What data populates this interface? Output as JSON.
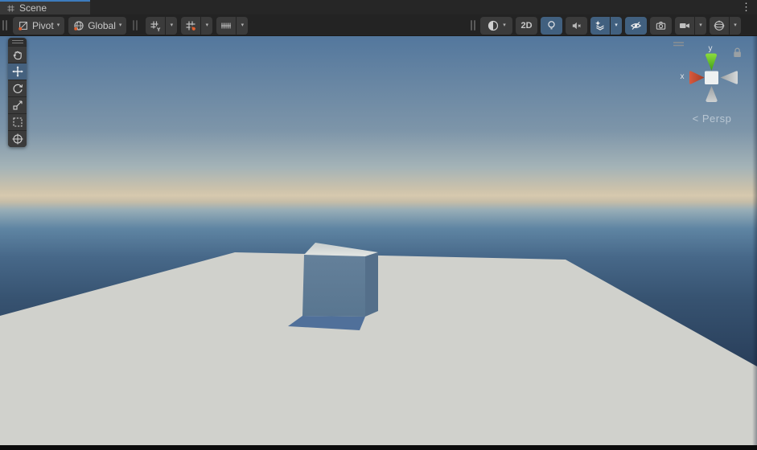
{
  "tabbar": {
    "tab_label": "Scene",
    "menu_glyph": "⋮"
  },
  "toolbar": {
    "pivot_label": "Pivot",
    "global_label": "Global",
    "two_d_label": "2D",
    "caret_glyph": "▾",
    "accent_orange": "#e0602f",
    "active_blue": "#41607f"
  },
  "tools": {
    "items": [
      "view-tool",
      "move-tool",
      "rotate-tool",
      "scale-tool",
      "rect-tool",
      "transform-tool"
    ],
    "selected": "move-tool"
  },
  "gizmo": {
    "x_label": "x",
    "y_label": "y",
    "persp_arrow": "<",
    "persp_label": "Persp",
    "x_color": "#c84a30",
    "y_color": "#63c62a",
    "neutral_color": "#c6c9cb",
    "center_color": "#eef1f2"
  },
  "scene": {
    "sky_stops": [
      "#53779d",
      "#7d95a9",
      "#a4b3b7",
      "#ccc2ab",
      "#d6c9ae",
      "#c6bda8",
      "#97adb7",
      "#5f85a3",
      "#476889",
      "#375371",
      "#2a405c",
      "#203147"
    ],
    "plane_color": "#d0d1cc",
    "cube_front_top": "#64809a",
    "cube_front_bottom": "#597690",
    "cube_right_color": "#546f8a",
    "cube_top_back": "#c7cdcd",
    "cube_top_front": "#e4e7e5",
    "shadow_color": "#50709a"
  }
}
